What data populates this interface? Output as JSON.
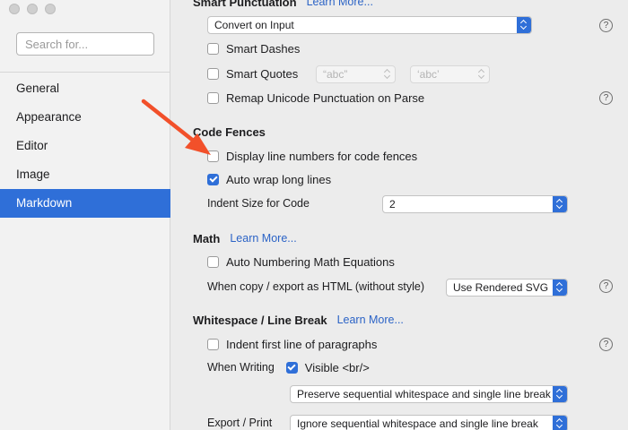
{
  "sidebar": {
    "search_placeholder": "Search for...",
    "items": [
      {
        "label": "General"
      },
      {
        "label": "Appearance"
      },
      {
        "label": "Editor"
      },
      {
        "label": "Image"
      },
      {
        "label": "Markdown"
      }
    ],
    "active_index": 4
  },
  "smart_punctuation": {
    "title": "Smart Punctuation",
    "learn_more": "Learn More...",
    "mode": "Convert on Input",
    "smart_dashes": {
      "label": "Smart Dashes",
      "checked": false
    },
    "smart_quotes": {
      "label": "Smart Quotes",
      "checked": false,
      "double_value": "“abc”",
      "single_value": "‘abc’"
    },
    "remap_unicode": {
      "label": "Remap Unicode Punctuation on Parse",
      "checked": false
    }
  },
  "code_fences": {
    "title": "Code Fences",
    "line_numbers": {
      "label": "Display line numbers for code fences",
      "checked": false
    },
    "auto_wrap": {
      "label": "Auto wrap long lines",
      "checked": true
    },
    "indent_label": "Indent Size for Code",
    "indent_value": "2"
  },
  "math": {
    "title": "Math",
    "learn_more": "Learn More...",
    "auto_numbering": {
      "label": "Auto Numbering Math Equations",
      "checked": false
    },
    "copy_export_label": "When copy / export as HTML (without style)",
    "copy_export_value": "Use Rendered SVG"
  },
  "whitespace": {
    "title": "Whitespace / Line Break",
    "learn_more": "Learn More...",
    "indent_first_line": {
      "label": "Indent first line of paragraphs",
      "checked": false
    },
    "when_writing_label": "When Writing",
    "visible_br": {
      "label": "Visible <br/>",
      "checked": true
    },
    "writing_mode": "Preserve sequential whitespace and single line break",
    "export_label": "Export / Print",
    "export_mode": "Ignore sequential whitespace and single line break"
  },
  "help_glyph": "?",
  "colors": {
    "accent": "#2f6fd8",
    "link": "#2b63c6",
    "annotation_arrow": "#f2502a"
  }
}
